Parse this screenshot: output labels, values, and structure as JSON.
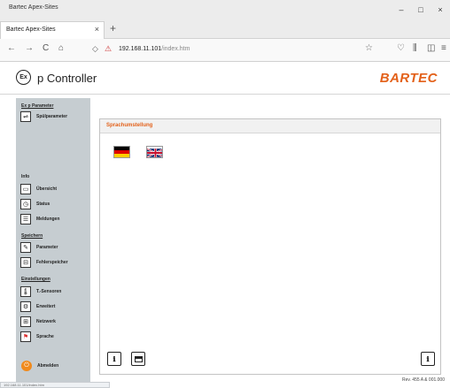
{
  "window": {
    "title": "Bartec Apex-Sites",
    "buttons": {
      "minimize": "–",
      "maximize": "□",
      "close": "×"
    }
  },
  "tab": {
    "label": "Bartec Apex-Sites",
    "close": "×",
    "new_tab": "+"
  },
  "navbar": {
    "back": "←",
    "forward": "→",
    "reload": "C",
    "home": "⌂",
    "url_host": "192.168.11.101",
    "url_path": "/index.htm",
    "icons": {
      "shield": "shield-icon",
      "lock": "lock-icon",
      "star": "star-icon",
      "pocket": "pocket-icon",
      "library": "library-icon",
      "sidebar": "sidebar-icon",
      "menu": "menu-icon"
    },
    "right_glyphs": {
      "pocket": "♡",
      "library": "⫼",
      "sidebar": "◫",
      "menu": "≡"
    }
  },
  "header": {
    "logo_text": "Ex",
    "title": "p Controller",
    "brand": "BARTEC",
    "brand_color": "#e3611a"
  },
  "sidebar": {
    "sections": [
      {
        "title": "Ex p Parameter",
        "items": [
          {
            "label": "Spülparameter",
            "icon": "flush-parameter-icon",
            "glyph": "⇌"
          }
        ]
      },
      {
        "title": "Info",
        "items": [
          {
            "label": "Übersicht",
            "icon": "overview-icon",
            "glyph": "▭"
          },
          {
            "label": "Status",
            "icon": "status-icon",
            "glyph": "◷"
          },
          {
            "label": "Meldungen",
            "icon": "messages-icon",
            "glyph": "☰"
          }
        ]
      },
      {
        "title": "Speichern",
        "items": [
          {
            "label": "Parameter",
            "icon": "parameter-save-icon",
            "glyph": "✎"
          },
          {
            "label": "Fehlerspeicher",
            "icon": "error-memory-icon",
            "glyph": "⊟"
          }
        ]
      },
      {
        "title": "Einstellungen",
        "items": [
          {
            "label": "T.-Sensoren",
            "icon": "temperature-sensor-icon",
            "glyph": "🌡"
          },
          {
            "label": "Erweitert",
            "icon": "advanced-icon",
            "glyph": "⚙"
          },
          {
            "label": "Netzwerk",
            "icon": "network-icon",
            "glyph": "⊞"
          },
          {
            "label": "Sprache",
            "icon": "language-icon",
            "glyph": "⚑"
          }
        ]
      }
    ],
    "logout": {
      "label": "Abmelden",
      "glyph": "⏻"
    }
  },
  "main": {
    "panel_title": "Sprachumstellung",
    "languages": [
      {
        "name": "de-flag-icon"
      },
      {
        "name": "gb-flag-icon"
      }
    ],
    "bottom_buttons": {
      "help": "ℹ",
      "window": "window-icon",
      "help_right": "ℹ"
    }
  },
  "footer": {
    "version": "Rev. 455 A & 001.000",
    "status_text": "192.168.11.101/index.htm"
  }
}
